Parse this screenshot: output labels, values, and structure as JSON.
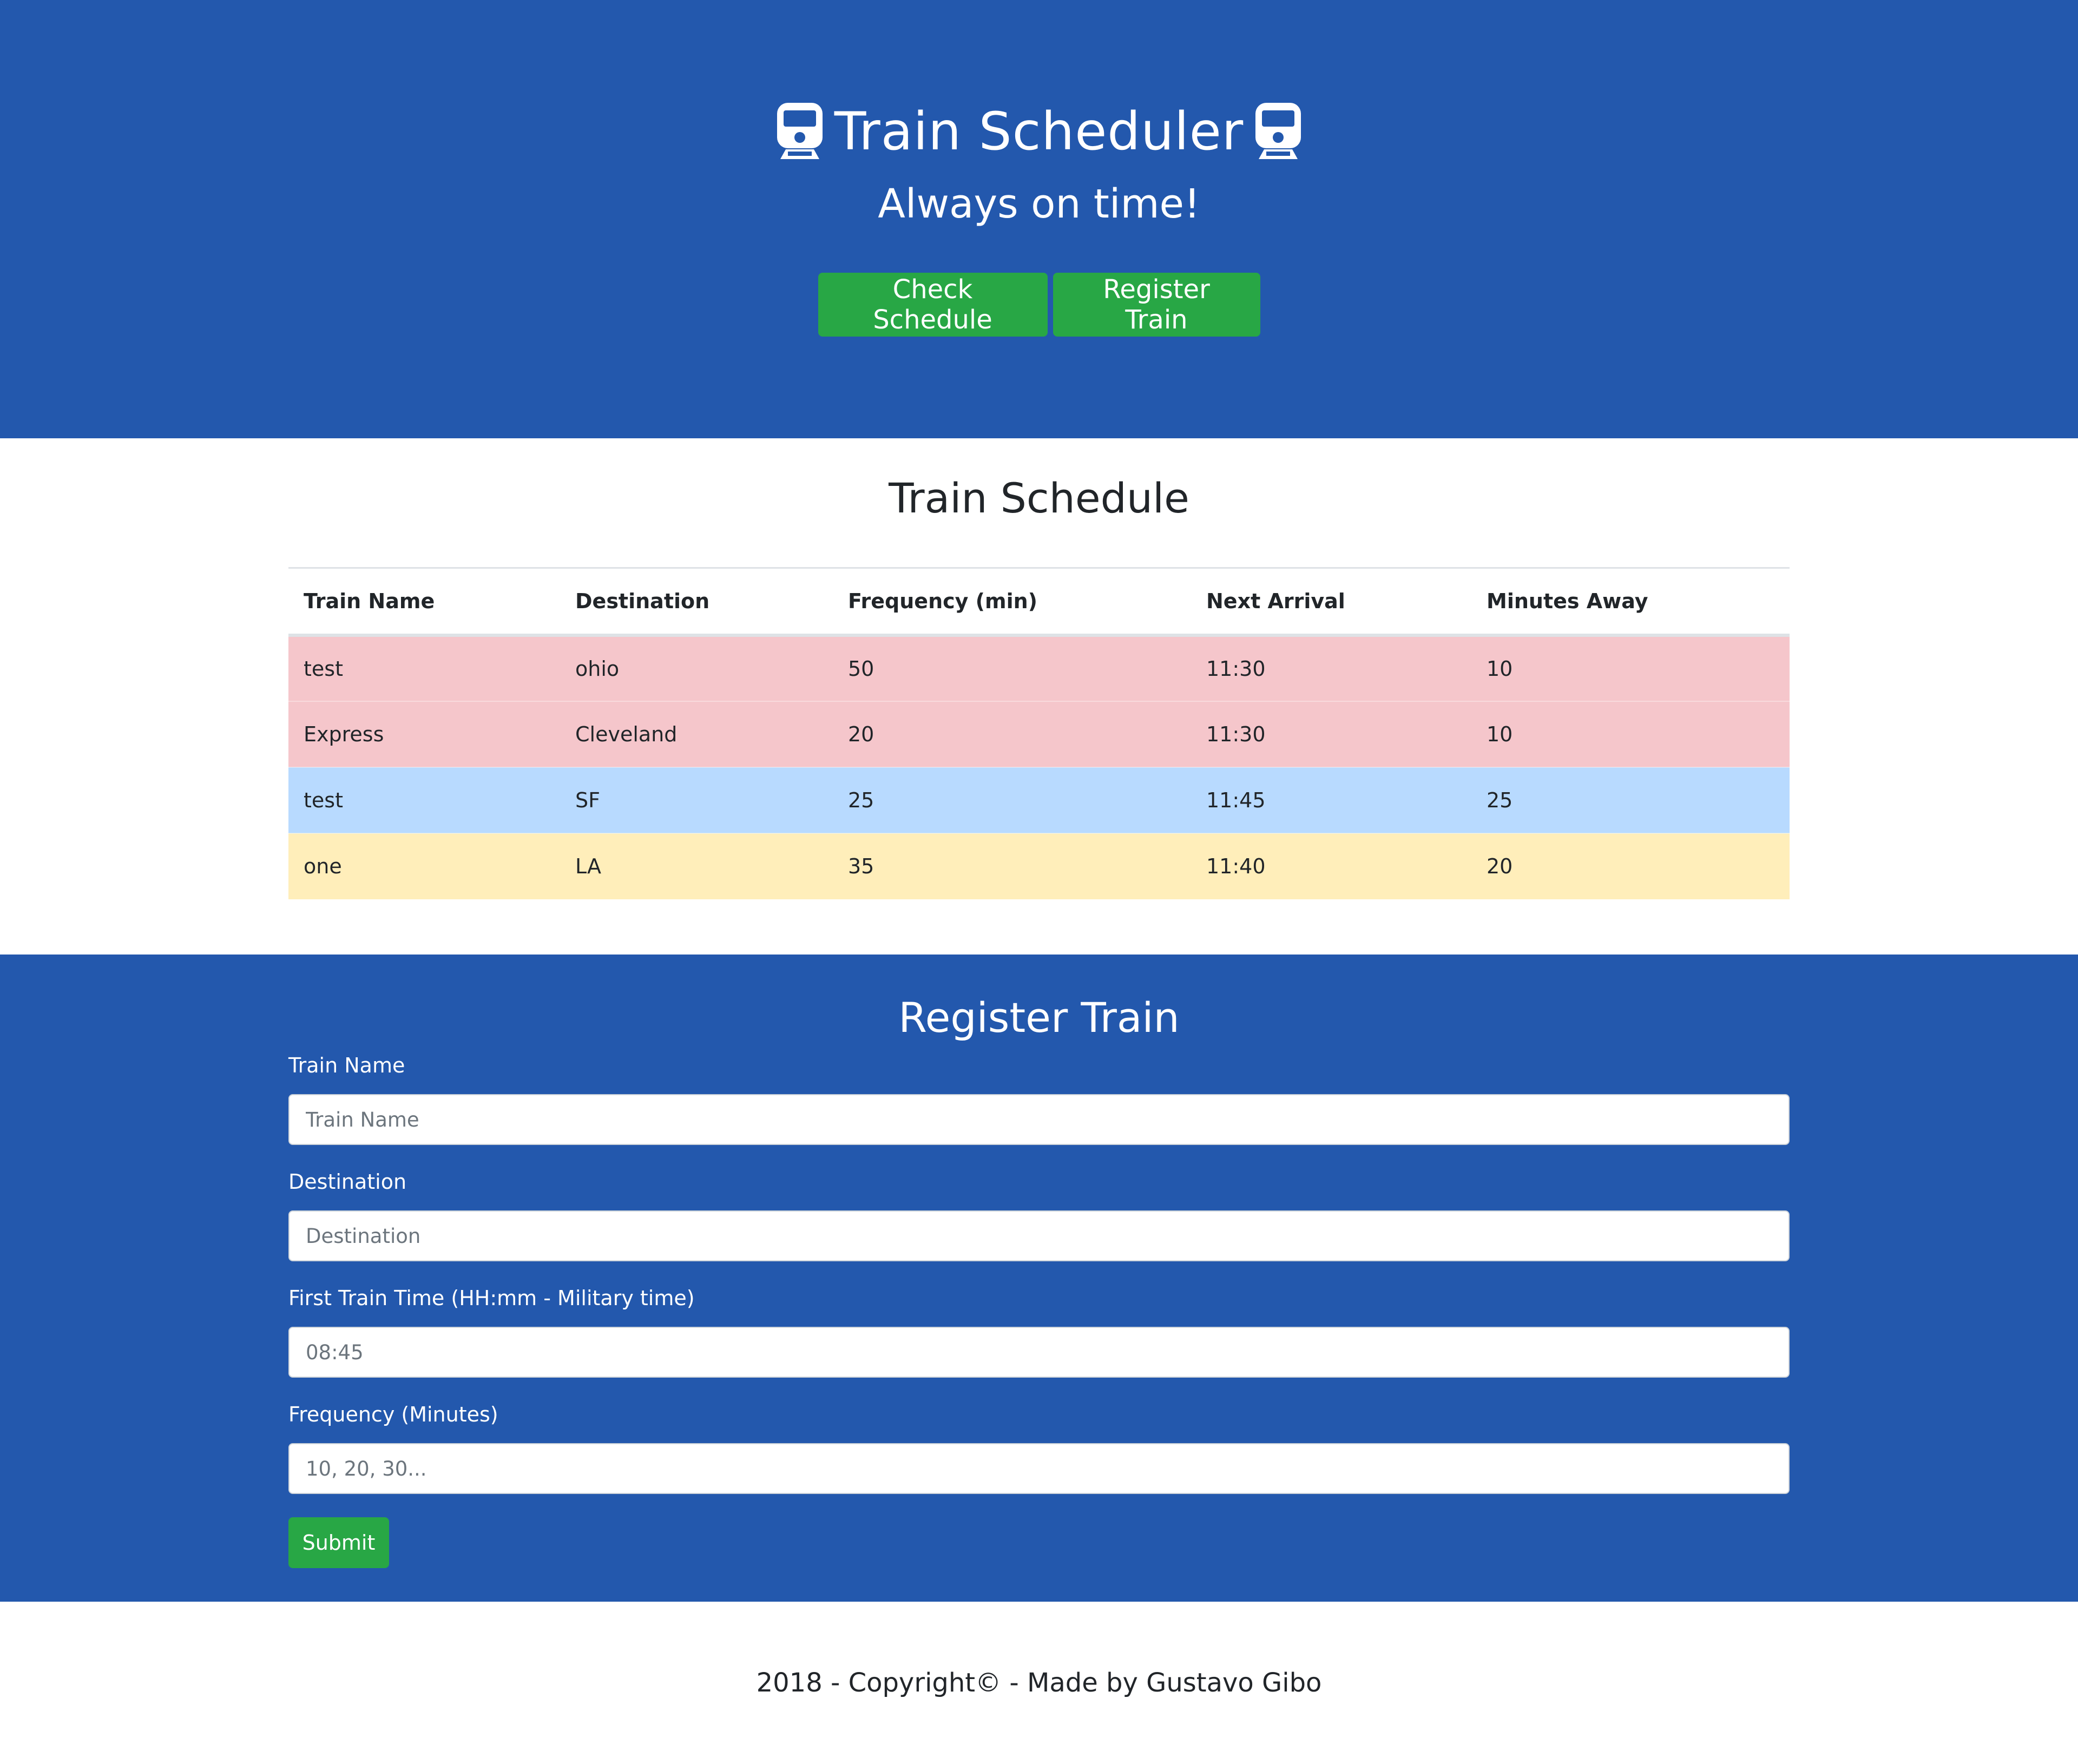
{
  "colors": {
    "header_bg": "#2358ad",
    "button_green": "#28a745",
    "row_danger": "#f5c6cb",
    "row_primary": "#b8daff",
    "row_warning": "#ffeeba"
  },
  "header": {
    "title": "Train Scheduler",
    "title_icon": "train-icon",
    "subtitle": "Always on time!",
    "check_schedule_label": "Check Schedule",
    "register_train_label": "Register Train"
  },
  "schedule": {
    "title": "Train Schedule",
    "columns": [
      "Train Name",
      "Destination",
      "Frequency (min)",
      "Next Arrival",
      "Minutes Away"
    ],
    "rows": [
      {
        "cells": [
          "test",
          "ohio",
          "50",
          "11:30",
          "10"
        ],
        "row_color": "#f5c6cb"
      },
      {
        "cells": [
          "Express",
          "Cleveland",
          "20",
          "11:30",
          "10"
        ],
        "row_color": "#f5c6cb"
      },
      {
        "cells": [
          "test",
          "SF",
          "25",
          "11:45",
          "25"
        ],
        "row_color": "#b8daff"
      },
      {
        "cells": [
          "one",
          "LA",
          "35",
          "11:40",
          "20"
        ],
        "row_color": "#ffeeba"
      }
    ]
  },
  "register": {
    "title": "Register Train",
    "fields": {
      "train_name": {
        "label": "Train Name",
        "placeholder": "Train Name"
      },
      "destination": {
        "label": "Destination",
        "placeholder": "Destination"
      },
      "first_time": {
        "label": "First Train Time (HH:mm - Military time)",
        "placeholder": "08:45"
      },
      "frequency": {
        "label": "Frequency (Minutes)",
        "placeholder": "10, 20, 30..."
      }
    },
    "submit_label": "Submit"
  },
  "footer": {
    "text": "2018 - Copyright© - Made by Gustavo Gibo"
  }
}
